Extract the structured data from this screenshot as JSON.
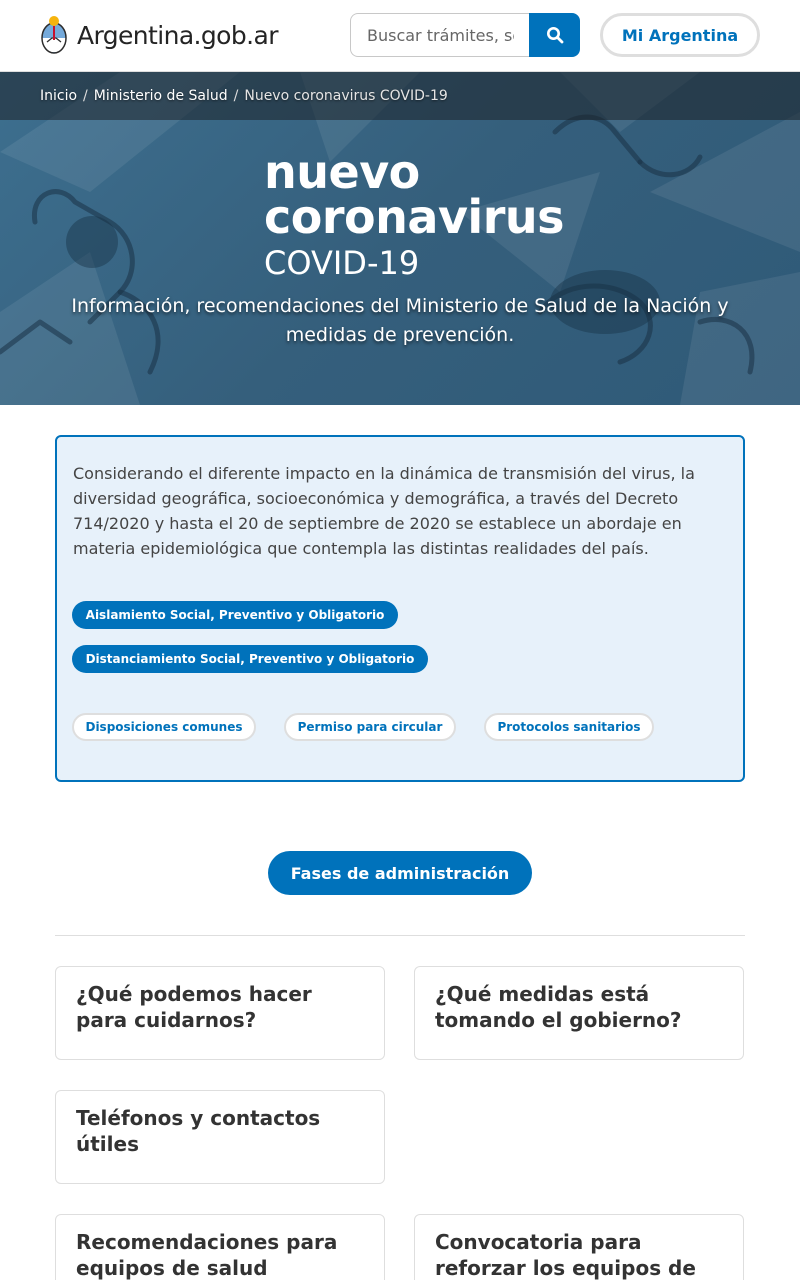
{
  "header": {
    "brand_text": "Argentina.gob.ar",
    "search_placeholder": "Buscar trámites, servicios o áreas",
    "mi_argentina_label": "Mi Argentina"
  },
  "breadcrumb": {
    "items": [
      "Inicio",
      "Ministerio de Salud"
    ],
    "current": "Nuevo coronavirus COVID-19",
    "separator": "/"
  },
  "hero": {
    "title_line1": "nuevo",
    "title_line2": "coronavirus",
    "title_line3": "COVID-19",
    "subtitle": "Información, recomendaciones del Ministerio de Salud de la Nación y medidas de prevención."
  },
  "alert": {
    "text": "Considerando el diferente impacto en la dinámica de transmisión del virus, la diversidad geográfica, socioeconómica y demográfica, a través del Decreto 714/2020 y hasta el 20 de septiembre de 2020 se establece un abordaje en materia epidemiológica que contempla las distintas realidades del país.",
    "primary_pills": [
      "Aislamiento Social, Preventivo y Obligatorio",
      "Distanciamiento Social, Preventivo y Obligatorio"
    ],
    "secondary_pills": [
      "Disposiciones comunes",
      "Permiso para circular",
      "Protocolos sanitarios"
    ]
  },
  "fases_button": "Fases de administración",
  "cards": [
    "¿Qué podemos hacer para cuidarnos?",
    "¿Qué medidas está tomando el gobierno?",
    "Teléfonos y contactos útiles",
    "Recomendaciones para equipos de salud",
    "Convocatoria para reforzar los equipos de"
  ],
  "colors": {
    "primary": "#0072bb",
    "alert_bg": "#e7f1fa",
    "hero_overlay": "#2f5a78"
  },
  "icons": {
    "search": "search-icon",
    "brand": "argentina-emblem-icon"
  }
}
